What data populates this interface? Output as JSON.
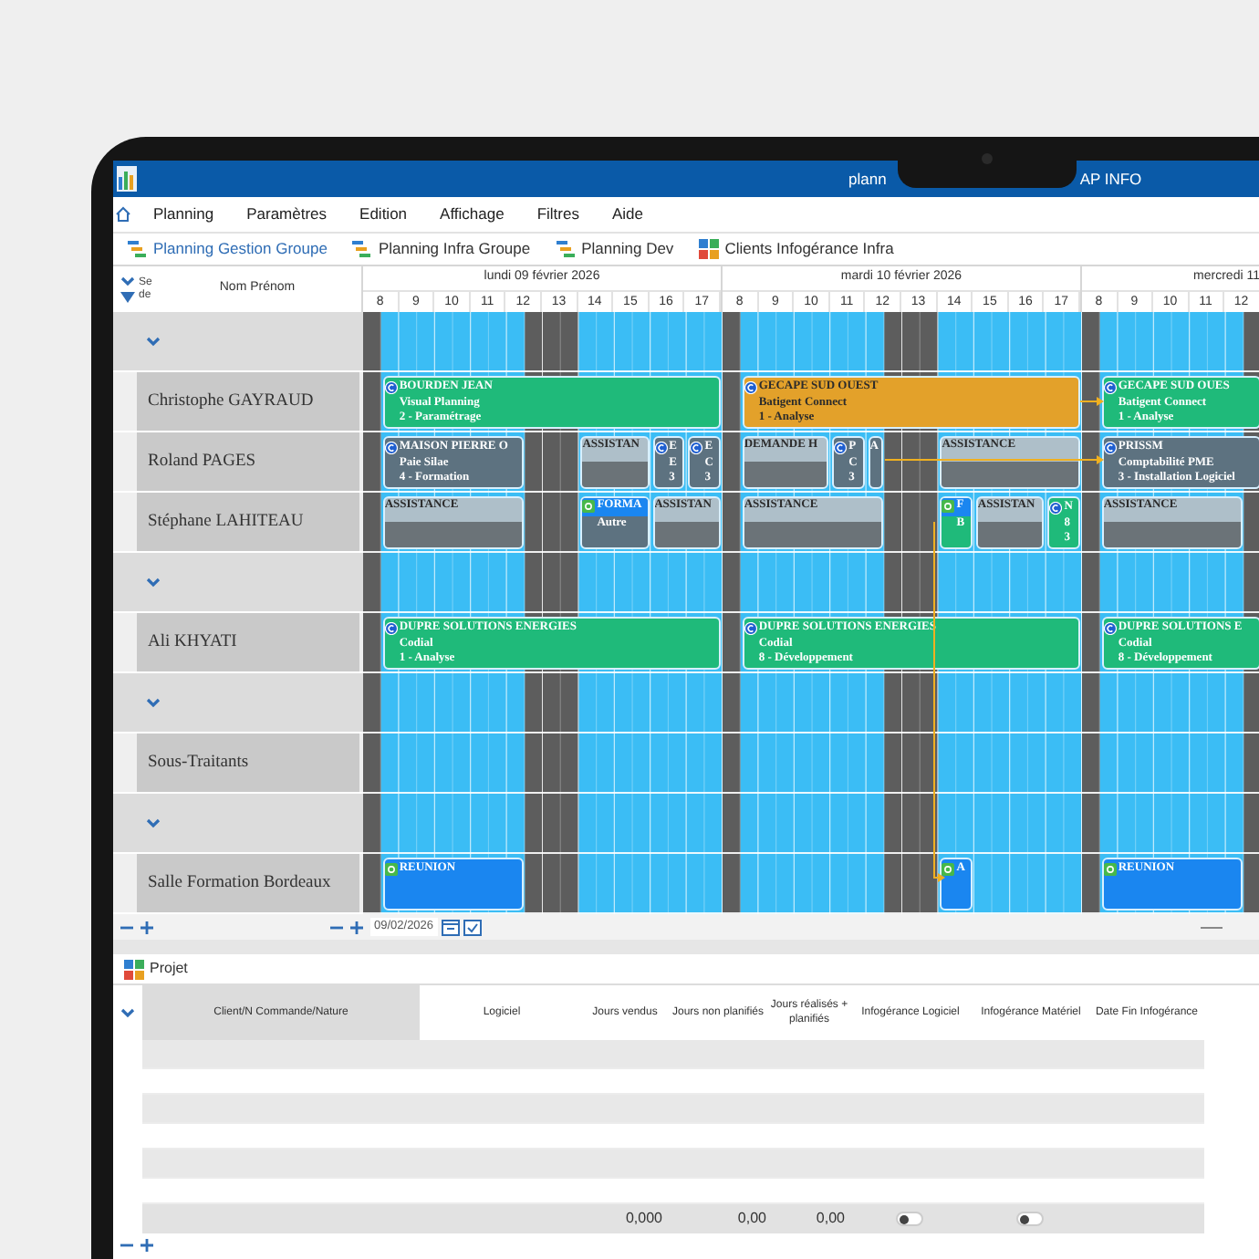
{
  "window": {
    "title_start": "plann",
    "title_end": "AP INFO"
  },
  "menu": [
    "Planning",
    "Paramètres",
    "Edition",
    "Affichage",
    "Filtres",
    "Aide"
  ],
  "tabs": [
    {
      "label": "Planning Gestion Groupe",
      "selected": true,
      "kind": "gantt"
    },
    {
      "label": "Planning Infra Groupe",
      "selected": false,
      "kind": "gantt"
    },
    {
      "label": "Planning Dev",
      "selected": false,
      "kind": "gantt"
    },
    {
      "label": "Clients Infogérance Infra",
      "selected": false,
      "kind": "tiles"
    }
  ],
  "planning": {
    "header": {
      "sort_label": "Se de",
      "name_column": "Nom Prénom"
    },
    "days": [
      {
        "label": "lundi 09 février 2026",
        "hours": [
          "8",
          "9",
          "10",
          "11",
          "12",
          "13",
          "14",
          "15",
          "16",
          "17"
        ]
      },
      {
        "label": "mardi 10 février 2026",
        "hours": [
          "8",
          "9",
          "10",
          "11",
          "12",
          "13",
          "14",
          "15",
          "16",
          "17"
        ]
      },
      {
        "label": "mercredi 11",
        "hours": [
          "8",
          "9",
          "10",
          "11",
          "12"
        ]
      }
    ],
    "rows": [
      {
        "kind": "group",
        "expanded": true
      },
      {
        "kind": "person",
        "name": "Christophe GAYRAUD",
        "days": [
          {
            "events": [
              {
                "kind": "project",
                "color": "#1fba7a",
                "title": "BOURDEN JEAN",
                "lines": [
                  "Visual Planning",
                  "2 - Paramétrage"
                ]
              }
            ]
          },
          {
            "events": [
              {
                "kind": "project",
                "color": "#e3a12a",
                "title": "GECAPE SUD OUEST",
                "lines": [
                  "Batigent Connect",
                  "1 - Analyse"
                ]
              }
            ]
          },
          {
            "events": [
              {
                "kind": "project",
                "color": "#1fba7a",
                "title": "GECAPE SUD OUES",
                "lines": [
                  "Batigent Connect",
                  "1 - Analyse"
                ]
              }
            ]
          }
        ]
      },
      {
        "kind": "person",
        "name": "Roland PAGES",
        "days": [
          {
            "events": [
              {
                "kind": "project",
                "color": "#5d7280",
                "title": "MAISON PIERRE O",
                "lines": [
                  "Paie Silae",
                  "4 - Formation"
                ]
              },
              {
                "kind": "assistance",
                "color": "#aebfc9",
                "title": "ASSISTAN"
              },
              {
                "kind": "project",
                "color": "#5d7280",
                "title": "E",
                "lines": [
                  "E",
                  "3"
                ]
              },
              {
                "kind": "project",
                "color": "#5d7280",
                "title": "E",
                "lines": [
                  "C",
                  "3"
                ]
              }
            ]
          },
          {
            "events": [
              {
                "kind": "assistance",
                "color": "#aebfc9",
                "title": "DEMANDE H"
              },
              {
                "kind": "project",
                "color": "#5d7280",
                "title": "P",
                "lines": [
                  "C",
                  "3"
                ]
              },
              {
                "kind": "task",
                "color": "#5d7280",
                "title": "A"
              },
              {
                "kind": "assistance",
                "color": "#aebfc9",
                "title": "ASSISTANCE"
              }
            ]
          },
          {
            "events": [
              {
                "kind": "project",
                "color": "#5d7280",
                "title": "PRISSM",
                "lines": [
                  "Comptabilité PME",
                  "3 - Installation Logiciel"
                ]
              }
            ]
          }
        ]
      },
      {
        "kind": "person",
        "name": "Stéphane LAHITEAU",
        "days": [
          {
            "events": [
              {
                "kind": "assistance",
                "color": "#aebfc9",
                "title": "ASSISTANCE"
              },
              {
                "kind": "training",
                "color": "#5d7280",
                "title": "FORMA",
                "lines": [
                  "Autre"
                ]
              },
              {
                "kind": "assistance",
                "color": "#aebfc9",
                "title": "ASSISTAN"
              }
            ]
          },
          {
            "events": [
              {
                "kind": "assistance",
                "color": "#aebfc9",
                "title": "ASSISTANCE"
              },
              {
                "kind": "training",
                "color": "#1fba7a",
                "title": "F",
                "lines": [
                  "B"
                ]
              },
              {
                "kind": "assistance",
                "color": "#aebfc9",
                "title": "ASSISTAN"
              },
              {
                "kind": "project",
                "color": "#1fba7a",
                "title": "N",
                "lines": [
                  "8",
                  "3"
                ]
              }
            ]
          },
          {
            "events": [
              {
                "kind": "assistance",
                "color": "#aebfc9",
                "title": "ASSISTANCE"
              }
            ]
          }
        ]
      },
      {
        "kind": "group",
        "expanded": true
      },
      {
        "kind": "person",
        "name": "Ali KHYATI",
        "days": [
          {
            "events": [
              {
                "kind": "project",
                "color": "#1fba7a",
                "title": "DUPRE SOLUTIONS ENERGIES",
                "lines": [
                  "Codial",
                  "1 - Analyse"
                ]
              }
            ]
          },
          {
            "events": [
              {
                "kind": "project",
                "color": "#1fba7a",
                "title": "DUPRE SOLUTIONS ENERGIES",
                "lines": [
                  "Codial",
                  "8 - Développement"
                ]
              }
            ]
          },
          {
            "events": [
              {
                "kind": "project",
                "color": "#1fba7a",
                "title": "DUPRE SOLUTIONS E",
                "lines": [
                  "Codial",
                  "8 - Développement"
                ]
              }
            ]
          }
        ]
      },
      {
        "kind": "group",
        "expanded": true
      },
      {
        "kind": "person",
        "name": "Sous-Traitants"
      },
      {
        "kind": "group",
        "expanded": true
      },
      {
        "kind": "person",
        "name": "Salle Formation Bordeaux",
        "days": [
          {
            "events": [
              {
                "kind": "meeting",
                "color": "#1a86f0",
                "title": "REUNION"
              }
            ]
          },
          {
            "events": [
              {
                "kind": "meeting",
                "color": "#1a86f0",
                "title": "A"
              }
            ]
          },
          {
            "events": [
              {
                "kind": "meeting",
                "color": "#1a86f0",
                "title": "REUNION"
              }
            ]
          }
        ]
      }
    ],
    "footer": {
      "date": "09/02/2026"
    }
  },
  "projet": {
    "title": "Projet",
    "columns": [
      "Client/N Commande/Nature",
      "Logiciel",
      "Jours vendus",
      "Jours non planifiés",
      "Jours réalisés + planifiés",
      "Infogérance Logiciel",
      "Infogérance Matériel",
      "Date Fin Infogérance"
    ],
    "totals": [
      {
        "kind": "blank"
      },
      {
        "kind": "blank"
      },
      {
        "kind": "text",
        "value": "0,000"
      },
      {
        "kind": "text",
        "value": "0,00"
      },
      {
        "kind": "text",
        "value": "0,00"
      },
      {
        "kind": "toggle",
        "on": false
      },
      {
        "kind": "toggle",
        "on": false
      },
      {
        "kind": "blank"
      }
    ]
  }
}
